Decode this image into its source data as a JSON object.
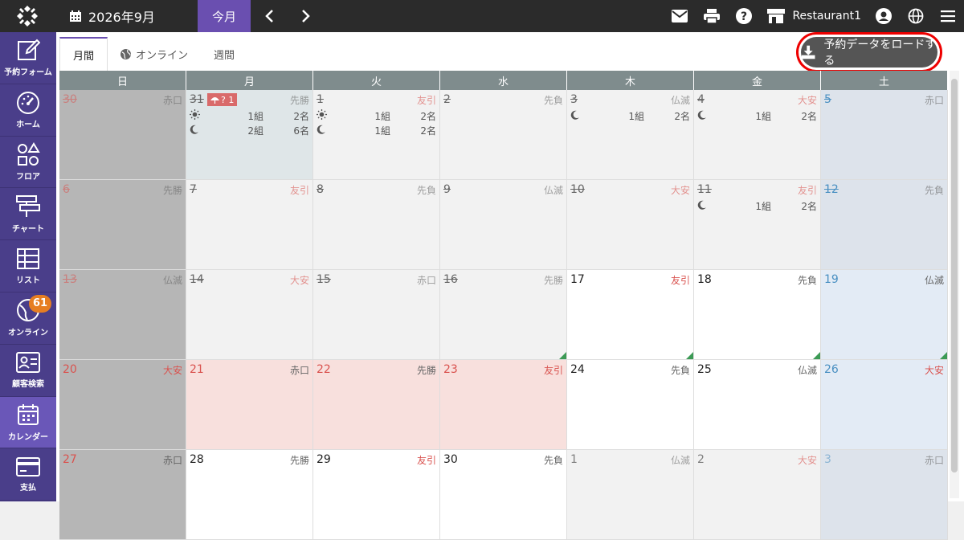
{
  "topbar": {
    "month": "2026年9月",
    "today": "今月",
    "restaurant": "Restaurant1"
  },
  "sidebar": {
    "items": [
      {
        "label": "予約フォーム",
        "icon": "edit-icon"
      },
      {
        "label": "ホーム",
        "icon": "gauge-icon"
      },
      {
        "label": "フロア",
        "icon": "floor-icon"
      },
      {
        "label": "チャート",
        "icon": "chart-icon"
      },
      {
        "label": "リスト",
        "icon": "list-icon"
      },
      {
        "label": "オンライン",
        "icon": "globe-icon",
        "badge": "61"
      },
      {
        "label": "顧客検索",
        "icon": "id-card-icon"
      },
      {
        "label": "カレンダー",
        "icon": "calendar-icon"
      },
      {
        "label": "支払",
        "icon": "card-icon"
      }
    ]
  },
  "tabs": {
    "month": "月間",
    "online": "オンライン",
    "week": "週間"
  },
  "download_label": "予約データをロードする",
  "weekdays": [
    "日",
    "月",
    "火",
    "水",
    "木",
    "金",
    "土"
  ],
  "weeks": [
    [
      {
        "d": "30",
        "r": "赤口"
      },
      {
        "d": "31",
        "r": "先勝",
        "event": "? 1",
        "lunch": {
          "g": "1組",
          "p": "2名"
        },
        "dinner": {
          "g": "2組",
          "p": "6名"
        }
      },
      {
        "d": "1",
        "r": "友引",
        "lunch": {
          "g": "1組",
          "p": "2名"
        },
        "dinner": {
          "g": "1組",
          "p": "2名"
        }
      },
      {
        "d": "2",
        "r": "先負"
      },
      {
        "d": "3",
        "r": "仏滅",
        "dinner": {
          "g": "1組",
          "p": "2名"
        }
      },
      {
        "d": "4",
        "r": "大安",
        "dinner": {
          "g": "1組",
          "p": "2名"
        }
      },
      {
        "d": "5",
        "r": "赤口"
      }
    ],
    [
      {
        "d": "6",
        "r": "先勝"
      },
      {
        "d": "7",
        "r": "友引"
      },
      {
        "d": "8",
        "r": "先負"
      },
      {
        "d": "9",
        "r": "仏滅"
      },
      {
        "d": "10",
        "r": "大安"
      },
      {
        "d": "11",
        "r": "友引",
        "dinner": {
          "g": "1組",
          "p": "2名"
        }
      },
      {
        "d": "12",
        "r": "先負"
      }
    ],
    [
      {
        "d": "13",
        "r": "仏滅"
      },
      {
        "d": "14",
        "r": "大安"
      },
      {
        "d": "15",
        "r": "赤口"
      },
      {
        "d": "16",
        "r": "先勝"
      },
      {
        "d": "17",
        "r": "友引"
      },
      {
        "d": "18",
        "r": "先負"
      },
      {
        "d": "19",
        "r": "仏滅"
      }
    ],
    [
      {
        "d": "20",
        "r": "大安"
      },
      {
        "d": "21",
        "r": "赤口"
      },
      {
        "d": "22",
        "r": "先勝"
      },
      {
        "d": "23",
        "r": "友引"
      },
      {
        "d": "24",
        "r": "先負"
      },
      {
        "d": "25",
        "r": "仏滅"
      },
      {
        "d": "26",
        "r": "大安"
      }
    ],
    [
      {
        "d": "27",
        "r": "赤口"
      },
      {
        "d": "28",
        "r": "先勝"
      },
      {
        "d": "29",
        "r": "友引"
      },
      {
        "d": "30",
        "r": "先負"
      },
      {
        "d": "1",
        "r": "仏滅"
      },
      {
        "d": "2",
        "r": "大安"
      },
      {
        "d": "3",
        "r": "赤口"
      }
    ]
  ],
  "colors": {
    "accent": "#6a4fb0",
    "sidebar": "#4a3e8a",
    "badge": "#e67e22",
    "highlight": "#e00000"
  }
}
